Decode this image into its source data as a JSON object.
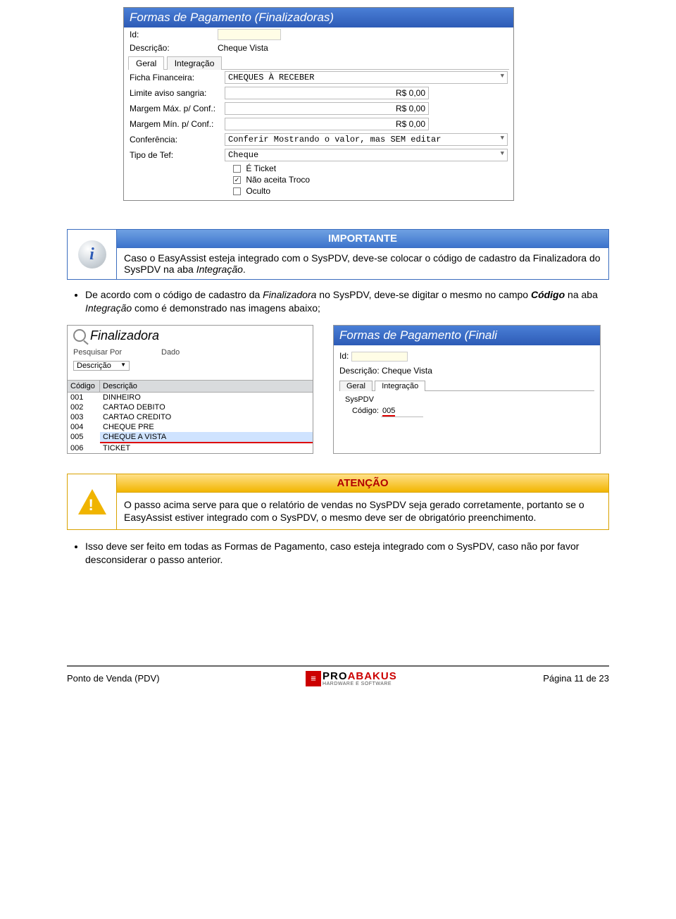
{
  "win1": {
    "title": "Formas de Pagamento (Finalizadoras)",
    "id_label": "Id:",
    "desc_label": "Descrição:",
    "desc_value": "Cheque Vista",
    "tab_geral": "Geral",
    "tab_integracao": "Integração",
    "ficha_label": "Ficha Financeira:",
    "ficha_value": "CHEQUES À RECEBER",
    "limite_label": "Limite aviso sangria:",
    "limite_value": "R$ 0,00",
    "margem_max_label": "Margem Máx. p/ Conf.:",
    "margem_max_value": "R$ 0,00",
    "margem_min_label": "Margem Mín. p/ Conf.:",
    "margem_min_value": "R$ 0,00",
    "conf_label": "Conferência:",
    "conf_value": "Conferir Mostrando o valor, mas SEM editar",
    "tef_label": "Tipo de Tef:",
    "tef_value": "Cheque",
    "chk1": "É Ticket",
    "chk2": "Não aceita Troco",
    "chk3": "Oculto"
  },
  "importante": {
    "title": "IMPORTANTE",
    "text_plain": "Caso o EasyAssist esteja integrado com o SysPDV, deve-se colocar o código de cadastro da Finalizadora do SysPDV na aba Integração."
  },
  "bullet1_plain": "De acordo com o código de cadastro da Finalizadora no SysPDV, deve-se digitar o mesmo no campo Código na aba Integração como é demonstrado nas imagens abaixo;",
  "finalizadora": {
    "title": "Finalizadora",
    "pesq_label": "Pesquisar Por",
    "pesq_value": "Descrição",
    "dado_label": "Dado",
    "col1": "Código",
    "col2": "Descrição",
    "rows": [
      {
        "c": "001",
        "d": "DINHEIRO"
      },
      {
        "c": "002",
        "d": "CARTAO DEBITO"
      },
      {
        "c": "003",
        "d": "CARTAO CREDITO"
      },
      {
        "c": "004",
        "d": "CHEQUE PRE"
      },
      {
        "c": "005",
        "d": "CHEQUE A VISTA"
      },
      {
        "c": "006",
        "d": "TICKET"
      }
    ]
  },
  "formas2": {
    "title": "Formas de Pagamento (Finali",
    "id_label": "Id:",
    "desc_label": "Descrição:",
    "desc_value": "Cheque Vista",
    "tab_geral": "Geral",
    "tab_integracao": "Integração",
    "group": "SysPDV",
    "codigo_label": "Código:",
    "codigo_value": "005"
  },
  "atencao": {
    "title": "ATENÇÃO",
    "text": "O passo acima serve para que o relatório de vendas no SysPDV seja gerado corretamente, portanto se o EasyAssist estiver integrado com o SysPDV, o mesmo deve ser de obrigatório preenchimento."
  },
  "bullet2": "Isso deve ser feito em todas as Formas de Pagamento, caso esteja integrado com o SysPDV, caso não por favor desconsiderar o passo anterior.",
  "footer": {
    "left": "Ponto de Venda (PDV)",
    "right": "Página 11 de 23",
    "logo_main1": "PRO",
    "logo_main2": "ABAKUS",
    "logo_sub": "HARDWARE E SOFTWARE"
  }
}
